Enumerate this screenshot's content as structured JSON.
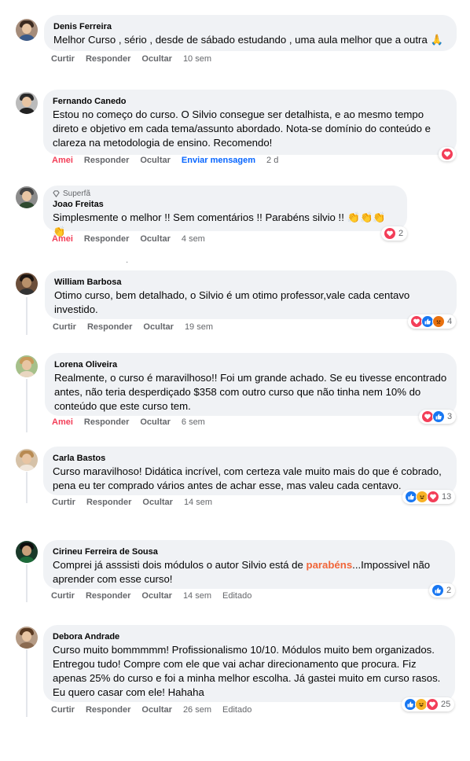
{
  "actions": {
    "like": "Curtir",
    "liked": "Amei",
    "reply": "Responder",
    "hide": "Ocultar",
    "send_message": "Enviar mensagem",
    "edited": "Editado"
  },
  "comments": [
    {
      "name": "Denis Ferreira",
      "text": "Melhor Curso , sério , desde de sábado estudando , uma aula melhor que a outra 🙏",
      "time": "10 sem",
      "liked": false
    },
    {
      "name": "Fernando Canedo",
      "text": "Estou no começo do curso. O Silvio consegue ser detalhista, e ao mesmo tempo direto e objetivo em cada tema/assunto abordado. Nota-se domínio do conteúdo e clareza na metodologia de ensino. Recomendo!",
      "time": "2 d",
      "liked": true
    },
    {
      "badge": "Superfã",
      "name": "Joao Freitas",
      "text": "Simplesmente o melhor !! Sem comentários !! Parabéns silvio !! 👏👏👏👏",
      "time": "4 sem",
      "liked": true,
      "reaction_count": "2"
    },
    {
      "name": "William Barbosa",
      "text": "Otimo curso, bem detalhado, o Silvio é um otimo professor,vale cada centavo investido.",
      "time": "19 sem",
      "liked": false,
      "reaction_count": "4"
    },
    {
      "name": "Lorena Oliveira",
      "text": "Realmente, o curso é maravilhoso!! Foi um grande achado. Se eu tivesse encontrado antes, não teria desperdiçado $358 com outro curso que não tinha nem 10% do conteúdo que este curso tem.",
      "time": "6 sem",
      "liked": true,
      "reaction_count": "3"
    },
    {
      "name": "Carla Bastos",
      "text": "Curso maravilhoso! Didática incrível, com certeza vale muito mais do que é cobrado, pena eu ter comprado vários antes de achar esse, mas valeu cada centavo.",
      "time": "14 sem",
      "liked": false,
      "reaction_count": "13"
    },
    {
      "name": "Cirineu Ferreira de Sousa",
      "text_before": "Comprei já asssisti dois módulos o autor Silvio está de ",
      "text_highlight": "parabéns",
      "text_after": "...Impossivel não aprender com esse curso!",
      "time": "14 sem",
      "liked": false,
      "reaction_count": "2"
    },
    {
      "name": "Debora Andrade",
      "text": "Curso muito bommmmm! Profissionalismo 10/10. Módulos muito bem organizados. Entregou tudo! Compre com ele que vai achar direcionamento que procura. Fiz apenas 25% do curso e foi a minha melhor escolha. Já gastei muito em curso rasos. Eu quero casar com ele! Hahaha",
      "time": "26 sem",
      "liked": false,
      "reaction_count": "25"
    }
  ],
  "colors": {
    "bubble": "#f0f2f5",
    "secondary_text": "#65676b",
    "love": "#f33e58",
    "like": "#1877f2",
    "link": "#0866ff",
    "highlight": "#f0663a"
  }
}
